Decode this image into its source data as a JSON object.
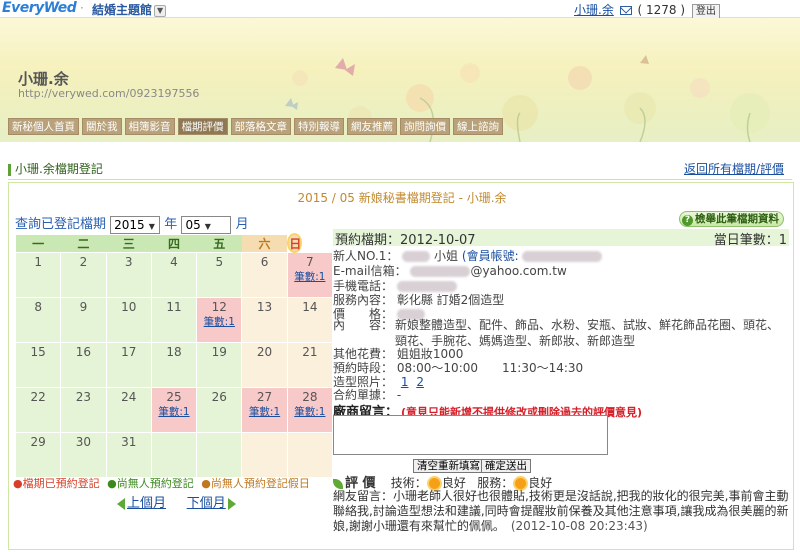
{
  "topbar": {
    "logo_main": "veryWed",
    "logo_prefix": "E",
    "separator": "·",
    "theme": "結婚主題館",
    "user": "小珊.余",
    "mail_count": "( 1278 )",
    "logout": "登出"
  },
  "banner": {
    "site_name": "小珊.余",
    "site_url": "http://verywed.com/0923197556",
    "nav": [
      "新秘個人首頁",
      "關於我",
      "相簿影音",
      "檔期評價",
      "部落格文章",
      "特別報導",
      "網友推薦",
      "詢問詢價",
      "線上諮詢"
    ]
  },
  "section": {
    "title": "小珊.余檔期登記",
    "back": "返回所有檔期/評價"
  },
  "calendar": {
    "title": "2015 / 05 新娘秘書檔期登記 - 小珊.余",
    "query_label": "查詢已登記檔期",
    "year": "2015",
    "year_unit": "年",
    "month": "05",
    "month_unit": "月",
    "weekdays": [
      "一",
      "二",
      "三",
      "四",
      "五",
      "六",
      "日"
    ],
    "count_label": "筆數:1",
    "weeks": [
      [
        "1",
        "2",
        "3",
        "4",
        "5",
        "6",
        "7"
      ],
      [
        "8",
        "9",
        "10",
        "11",
        "12",
        "13",
        "14"
      ],
      [
        "15",
        "16",
        "17",
        "18",
        "19",
        "20",
        "21"
      ],
      [
        "22",
        "23",
        "24",
        "25",
        "26",
        "27",
        "28"
      ],
      [
        "29",
        "30",
        "31",
        "",
        "",
        "",
        ""
      ]
    ],
    "legend": [
      "●檔期已預約登記",
      "●尚無人預約登記",
      "●尚無人預約登記假日"
    ],
    "prev": "上個月",
    "next": "下個月"
  },
  "detail": {
    "button": "檢舉此筆檔期資料",
    "date_label": "預約檔期：",
    "date": "2012-10-07",
    "count_label": "當日筆數：",
    "count": "1",
    "bride_label": "新人NO.1：",
    "bride_suffix": "小姐",
    "account_label": "(會員帳號:",
    "email_label": "E-mail信箱：",
    "email_suffix": "@yahoo.com.tw",
    "phone_label": "手機電話：",
    "service_label": "服務內容：",
    "service": "彰化縣 訂婚2個造型",
    "price_label": "價　　格：",
    "content_label": "內　　容：",
    "content": "新娘整體造型、配件、飾品、水粉、安瓶、試妝、鮮花飾品花圈、頭花、頸花、手腕花、媽媽造型、新郎妝、新郎造型",
    "other_fee_label": "其他花費：",
    "other_fee": "姐姐妝1000",
    "time_label": "預約時段：",
    "time": "08:00～10:00　　11:30～14:30",
    "photo_label": "造型照片：",
    "photo_links": [
      "1",
      "2"
    ],
    "contract_label": "合約單據：",
    "contract": "-",
    "msg_title": "廠商留言：",
    "msg_warn": "(意見只能新增不提供修改或刪除過去的評價意見)",
    "btn_clear": "清空重新填寫",
    "btn_send": "確定送出",
    "eval_title": "評 價",
    "eval_skill_label": "技術：",
    "eval_skill": "良好",
    "eval_service_label": "服務：",
    "eval_service": "良好",
    "review": "網友留言：小珊老師人很好也很體貼,技術更是沒話說,把我的妝化的很完美,事前會主動聯絡我,討論造型想法和建議,同時會提醒妝前保養及其他注意事項,讓我成為很美麗的新娘,謝謝小珊還有來幫忙的佩佩。",
    "review_time": "(2012-10-08 20:23:43)"
  }
}
